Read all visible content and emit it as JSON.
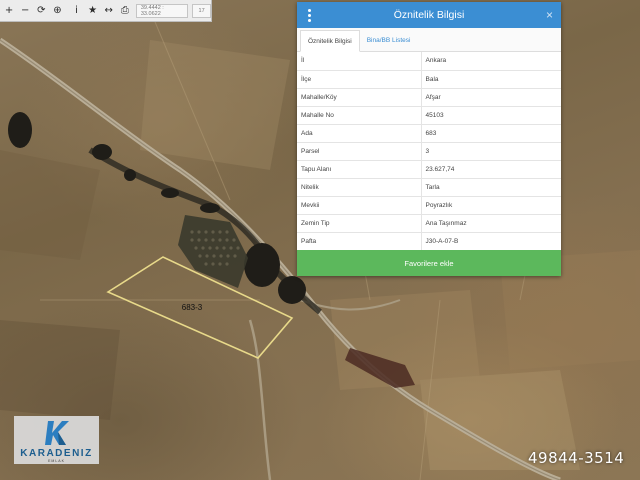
{
  "toolbar": {
    "buttons": [
      {
        "name": "zoom-in-icon",
        "glyph": "+"
      },
      {
        "name": "zoom-out-icon",
        "glyph": "−"
      },
      {
        "name": "refresh-icon",
        "glyph": "⟳"
      },
      {
        "name": "locate-icon",
        "glyph": "⊕"
      },
      {
        "name": "info-icon",
        "glyph": "i"
      },
      {
        "name": "favorite-star-icon",
        "glyph": "★"
      },
      {
        "name": "measure-icon",
        "glyph": "↔"
      },
      {
        "name": "print-icon",
        "glyph": "⎙"
      }
    ],
    "coordinates": "39.4442 : 33.0622",
    "zoom": "17"
  },
  "map": {
    "parcel_label": "683-3",
    "parcel_outline_color": "#e8d98a"
  },
  "panel": {
    "title": "Öznitelik Bilgisi",
    "menu_icon": "vertical-dots-icon",
    "close_label": "×",
    "header_color": "#3b8ed3",
    "tabs": [
      {
        "label": "Öznitelik Bilgisi",
        "active": true
      },
      {
        "label": "Bina/BB Listesi",
        "active": false
      }
    ],
    "attributes": [
      {
        "key": "İl",
        "value": "Ankara"
      },
      {
        "key": "İlçe",
        "value": "Bala"
      },
      {
        "key": "Mahalle/Köy",
        "value": "Afşar"
      },
      {
        "key": "Mahalle No",
        "value": "45103"
      },
      {
        "key": "Ada",
        "value": "683"
      },
      {
        "key": "Parsel",
        "value": "3"
      },
      {
        "key": "Tapu Alanı",
        "value": "23.627,74"
      },
      {
        "key": "Nitelik",
        "value": "Tarla"
      },
      {
        "key": "Mevkii",
        "value": "Poyrazlık"
      },
      {
        "key": "Zemin Tip",
        "value": "Ana Taşınmaz"
      },
      {
        "key": "Pafta",
        "value": "J30-A-07-B"
      }
    ],
    "favorite_button": "Favorilere ekle",
    "favorite_color": "#5cb85c"
  },
  "logo": {
    "text": "KARADENIZ",
    "subtext": "EMLAK"
  },
  "phone": "49844-3514"
}
